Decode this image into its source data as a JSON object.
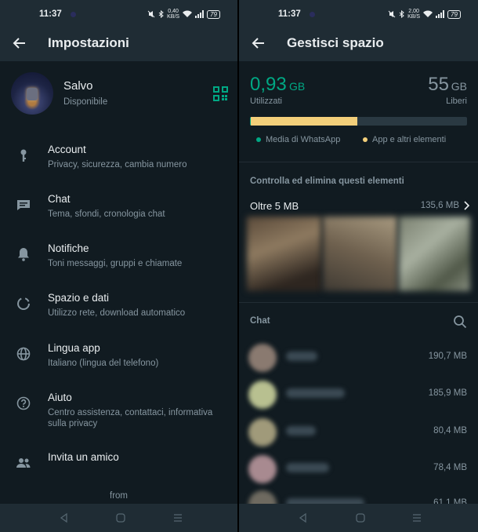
{
  "left": {
    "status": {
      "time": "11:37",
      "net_speed": "0,40",
      "net_unit": "KB/S",
      "battery": "79"
    },
    "title": "Impostazioni",
    "profile": {
      "name": "Salvo",
      "status": "Disponibile"
    },
    "items": [
      {
        "label": "Account",
        "sub": "Privacy, sicurezza, cambia numero",
        "icon": "key-icon"
      },
      {
        "label": "Chat",
        "sub": "Tema, sfondi, cronologia chat",
        "icon": "chat-icon"
      },
      {
        "label": "Notifiche",
        "sub": "Toni messaggi, gruppi e chiamate",
        "icon": "bell-icon"
      },
      {
        "label": "Spazio e dati",
        "sub": "Utilizzo rete, download automatico",
        "icon": "data-usage-icon"
      },
      {
        "label": "Lingua app",
        "sub": "Italiano (lingua del telefono)",
        "icon": "globe-icon"
      },
      {
        "label": "Aiuto",
        "sub": "Centro assistenza, contattaci, informativa sulla privacy",
        "icon": "help-icon"
      },
      {
        "label": "Invita un amico",
        "sub": "",
        "icon": "people-icon"
      }
    ],
    "footer": "from"
  },
  "right": {
    "status": {
      "time": "11:37",
      "net_speed": "2,00",
      "net_unit": "KB/S",
      "battery": "79"
    },
    "title": "Gestisci spazio",
    "used": {
      "value": "0,93",
      "unit": "GB",
      "label": "Utilizzati"
    },
    "free": {
      "value": "55",
      "unit": "GB",
      "label": "Liberi"
    },
    "usage_fraction": {
      "whatsapp": 0.003,
      "apps": 0.49
    },
    "legend": {
      "whatsapp": "Media di WhatsApp",
      "apps": "App e altri elementi"
    },
    "review_title": "Controlla ed elimina questi elementi",
    "large_files": {
      "label": "Oltre 5 MB",
      "size": "135,6 MB"
    },
    "chats_title": "Chat",
    "chats": [
      {
        "size": "190,7 MB"
      },
      {
        "size": "185,9 MB"
      },
      {
        "size": "80,4 MB"
      },
      {
        "size": "78,4 MB"
      },
      {
        "size": "61,1 MB"
      }
    ]
  },
  "colors": {
    "accent": "#00a884",
    "apps": "#f3cf7a",
    "bg": "#111b21",
    "bar": "#1f2c34"
  }
}
